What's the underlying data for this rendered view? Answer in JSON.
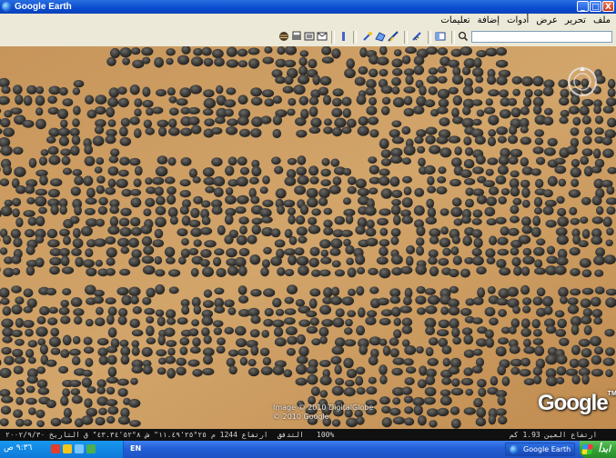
{
  "window": {
    "title": "Google Earth"
  },
  "window_controls": {
    "minimize": "_",
    "maximize": "□",
    "close": "X"
  },
  "menu": {
    "items": [
      "ملف",
      "تحرير",
      "عرض",
      "أدوات",
      "إضافة",
      "تعليمات"
    ]
  },
  "search": {
    "value": ""
  },
  "map": {
    "credit_line1": "Image © 2010 DigitalGlobe",
    "credit_line2": "© 2010 Google",
    "logo": "Google",
    "logo_mark": "TM"
  },
  "status": {
    "date": "التاريخ ٢٠٠٢/٩/٣٠",
    "coords": "٢٥°٢٥'١١.٤٩\" ش  ٨°٥٢'٤٣.٣٤\" ق",
    "elevation": "ارتفاع 1244 م",
    "streaming": "التدفق",
    "streaming_percent": "100%",
    "eye_alt": "ارتفاع العين  1.93 كم"
  },
  "taskbar": {
    "clock": "٩:٣٦ ص",
    "language": "EN",
    "task_label": "Google Earth",
    "start_label": "ابدأ"
  },
  "colors": {
    "titlebar": "#0a4bd0",
    "chrome": "#ece9d8",
    "sand": "#c89a5a",
    "rock": "#3a3a38",
    "taskbar": "#245ed6",
    "start": "#35a335"
  },
  "icons": [
    "google-earth-icon",
    "globe-icon",
    "print-icon",
    "email-icon",
    "sun-icon",
    "sky-icon",
    "ruler-icon",
    "placemark-icon",
    "polygon-icon",
    "path-icon",
    "overlay-icon",
    "sidebar-icon",
    "search-icon",
    "compass-icon"
  ]
}
